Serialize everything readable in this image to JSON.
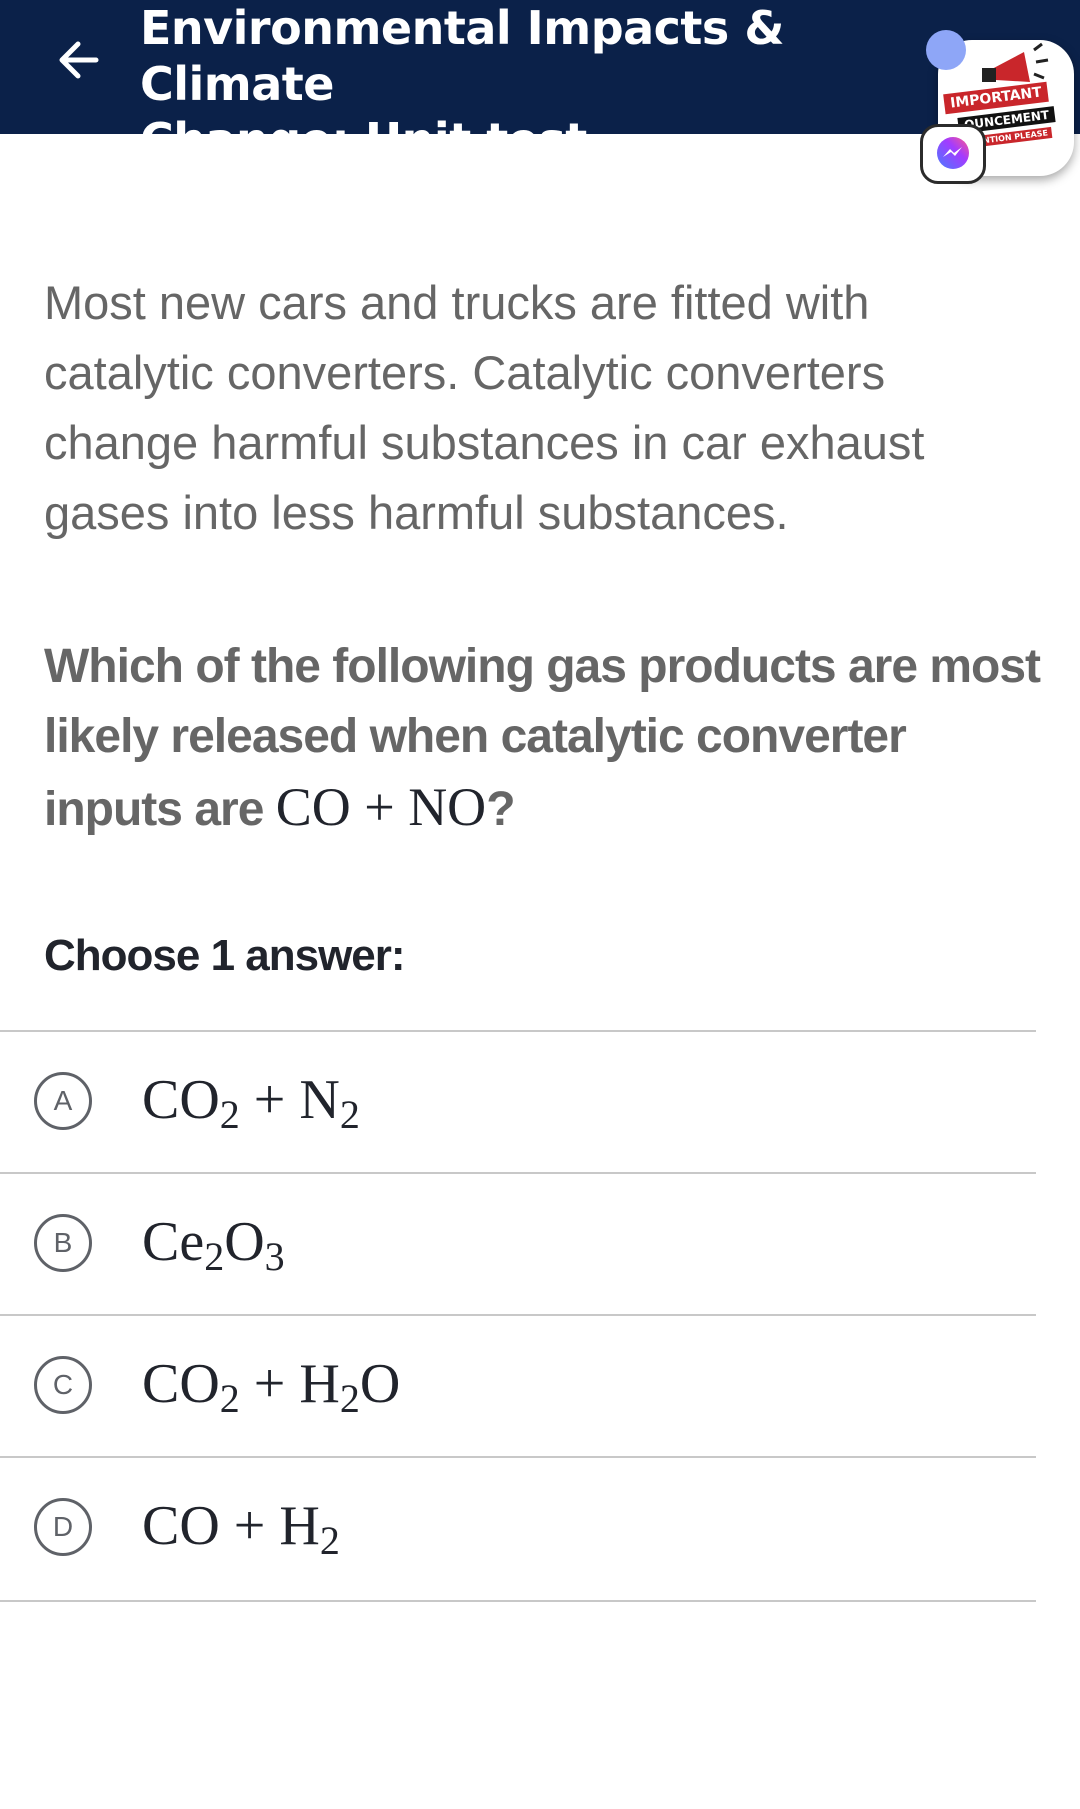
{
  "header": {
    "back_icon": "arrow-left-icon",
    "title_line1": "Environmental Impacts & Climate",
    "title_line2": "Change: Unit test",
    "background_color": "#0b2149"
  },
  "floating_bubble": {
    "announcement_line1": "IMPORTANT",
    "announcement_line2": "OUNCEMENT",
    "announcement_line3": "TENTION PLEASE",
    "messenger_icon": "messenger-icon"
  },
  "passage": {
    "text": "Most new cars and trucks are fitted with catalytic converters. Catalytic converters change harmful substances in car exhaust gases into less harmful substances."
  },
  "question": {
    "text_before": "Which of the following gas products are most likely released when catalytic converter inputs are ",
    "math": "CO + NO",
    "text_after": "?"
  },
  "choose_label": "Choose 1 answer:",
  "choices": [
    {
      "letter": "A",
      "parts": [
        {
          "t": "CO"
        },
        {
          "sub": "2"
        },
        {
          "t": " + N"
        },
        {
          "sub": "2"
        }
      ]
    },
    {
      "letter": "B",
      "parts": [
        {
          "t": "Ce"
        },
        {
          "sub": "2"
        },
        {
          "t": "O"
        },
        {
          "sub": "3"
        }
      ]
    },
    {
      "letter": "C",
      "parts": [
        {
          "t": "CO"
        },
        {
          "sub": "2"
        },
        {
          "t": " + H"
        },
        {
          "sub": "2"
        },
        {
          "t": "O"
        }
      ]
    },
    {
      "letter": "D",
      "parts": [
        {
          "t": "CO + H"
        },
        {
          "sub": "2"
        }
      ]
    }
  ]
}
